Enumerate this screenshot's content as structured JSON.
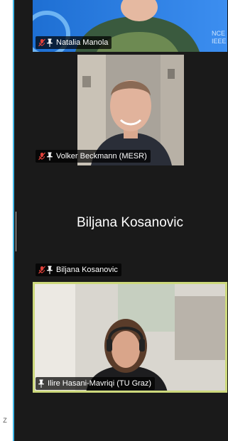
{
  "side_hint": "Z",
  "participants": [
    {
      "name": "Natalia Manola",
      "audio_muted": true,
      "pinned": true,
      "video_on": true,
      "logo_text": "NCE\nIEEE"
    },
    {
      "name": "Volker Beckmann (MESR)",
      "audio_muted": true,
      "pinned": true,
      "video_on": true
    },
    {
      "name": "Biljana Kosanovic",
      "placeholder_name": "Biljana Kosanovic",
      "audio_muted": true,
      "pinned": true,
      "video_on": false
    },
    {
      "name": "Ilire Hasani-Mavriqi (TU Graz)",
      "audio_muted": false,
      "pinned": true,
      "video_on": true,
      "active_speaker": true
    }
  ],
  "colors": {
    "speaker_border": "#cdd97c",
    "muted_icon": "#e0413a",
    "accent_strip": "#3fb7e8"
  }
}
